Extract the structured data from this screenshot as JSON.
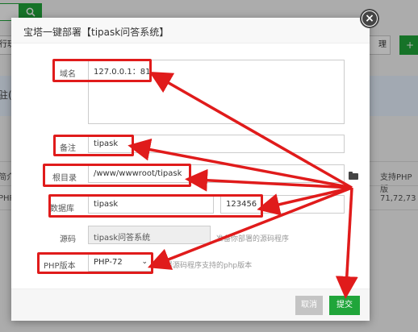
{
  "background": {
    "toolbar_partial": "行玩",
    "manage_partial": "理",
    "add_partial": "+",
    "band_partial": "驻(",
    "col_left_partial": "简介",
    "col_right_header": "支持PHP版",
    "row_left_partial": "PHP",
    "row_right_value": "71,72,73"
  },
  "dialog": {
    "title": "宝塔一键部署【tipask问答系统】",
    "close_glyph": "×",
    "domain": {
      "label": "域名",
      "value": "127.0.0.1：81"
    },
    "remark": {
      "label": "备注",
      "value": "tipask"
    },
    "root": {
      "label": "根目录",
      "value": "/www/wwwroot/tipask"
    },
    "database": {
      "label": "数据库",
      "name": "tipask",
      "password": "123456"
    },
    "source": {
      "label": "源码",
      "value": "tipask问答系统",
      "hint": "准备你部署的源码程序"
    },
    "php": {
      "label": "PHP版本",
      "selected": "PHP-72",
      "hint": "选择源码程序支持的php版本"
    },
    "cancel_label": "取消",
    "submit_label": "提交"
  },
  "colors": {
    "accent_green": "#20a53a",
    "annotation_red": "#e01b1b"
  },
  "icons": {
    "search": "search-icon",
    "close": "close-icon",
    "folder": "folder-open-icon",
    "chevron": "chevron-down-icon"
  }
}
